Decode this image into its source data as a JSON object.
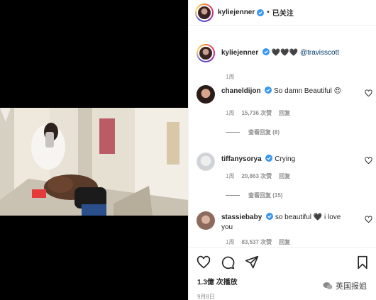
{
  "post": {
    "username": "kyliejenner",
    "follow_label": "已关注",
    "dot": "•",
    "caption_text": "🖤🖤🖤",
    "caption_mention": "@travisscott",
    "caption_time": "1周"
  },
  "comments": [
    {
      "username": "chaneldijon",
      "text": "So damn Beautiful 😍",
      "time": "1周",
      "likes": "15,736 次赞",
      "reply": "回复",
      "view_replies": "查看回复 (8)"
    },
    {
      "username": "tiffanysorya",
      "text": "Crying",
      "time": "1周",
      "likes": "20,863 次赞",
      "reply": "回复",
      "view_replies": "查看回复 (15)"
    },
    {
      "username": "stassiebaby",
      "text": "so beautiful 🖤 i love you",
      "time": "1周",
      "likes": "83,537 次赞",
      "reply": "回复"
    }
  ],
  "stats": {
    "views": "1.3億 次播放",
    "date": "9月8日"
  },
  "watermark": "英国报姐",
  "colors": {
    "verified": "#3897f0",
    "mention": "#00376b",
    "muted": "#8e8e8e"
  }
}
